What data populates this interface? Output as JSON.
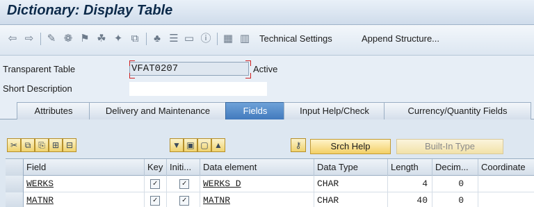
{
  "window": {
    "title": "Dictionary: Display Table"
  },
  "toolbar": {
    "icons": [
      "back-arrow-icon",
      "forward-arrow-icon",
      "display-change-icon",
      "other-object-icon",
      "activate-icon",
      "check-icon",
      "where-used-icon",
      "object-list-icon",
      "navigate-icon",
      "info-icon",
      "hierarchy-icon",
      "table-icon"
    ],
    "technical_settings": "Technical Settings",
    "append_structure": "Append Structure..."
  },
  "form": {
    "transparent_table_label": "Transparent Table",
    "table_name": "VFAT0207",
    "status": "Active",
    "short_description_label": "Short Description",
    "short_description": ""
  },
  "tabs": [
    "Attributes",
    "Delivery and Maintenance",
    "Fields",
    "Input Help/Check",
    "Currency/Quantity Fields"
  ],
  "buttons": {
    "srch_help": "Srch Help",
    "built_in_type": "Built-In Type"
  },
  "table": {
    "columns": [
      "Field",
      "Key",
      "Initi...",
      "Data element",
      "Data Type",
      "Length",
      "Decim...",
      "Coordinate"
    ],
    "rows": [
      {
        "field": "WERKS",
        "key": "✓",
        "initial": "✓",
        "data_element": "WERKS_D",
        "data_type": "CHAR",
        "length": "4",
        "decimals": "0"
      },
      {
        "field": "MATNR",
        "key": "✓",
        "initial": "✓",
        "data_element": "MATNR",
        "data_type": "CHAR",
        "length": "40",
        "decimals": "0"
      }
    ]
  }
}
